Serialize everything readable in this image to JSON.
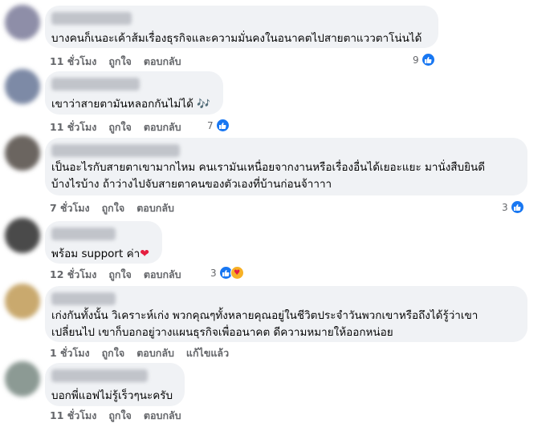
{
  "comments": [
    {
      "text": "บางคนก็เนอะเค้าส้มเรื่องธุรกิจและความมั่นคงในอนาคตไปสายตาแววตาโน่นได้",
      "time": "11 ชั่วโมง",
      "like": "ถูกใจ",
      "reply": "ตอบกลับ",
      "reactions": "9",
      "avatar_color": "#8e8ea8"
    },
    {
      "text": "เขาว่าสายตามันหลอกกันไม่ได้ 🎶",
      "time": "11 ชั่วโมง",
      "like": "ถูกใจ",
      "reply": "ตอบกลับ",
      "reactions": "7",
      "avatar_color": "#7d8aa6"
    },
    {
      "text": "เป็นอะไรกับสายตาเขามากไหม คนเรามันเหนื่อยจากงานหรือเรื่องอื่นได้เยอะแยะ มานั่งสืบยินดี\nบ้างไรบ้าง ถ้าว่างไปจับสายตาคนของตัวเองที่บ้านก่อนจ้าาาา",
      "time": "7 ชั่วโมง",
      "like": "ถูกใจ",
      "reply": "ตอบกลับ",
      "reactions": "3",
      "avatar_color": "#6b6560"
    },
    {
      "text": "พร้อม support ค่า",
      "heart": "❤",
      "time": "12 ชั่วโมง",
      "like": "ถูกใจ",
      "reply": "ตอบกลับ",
      "reactions": "3",
      "avatar_color": "#4a4a4a"
    },
    {
      "text": "เก่งกันทั้งนั้น วิเคราะห์เก่ง พวกคุณๆทั้งหลายคุณอยู่ในชีวิตประจำวันพวกเขาหรือถึงได้รู้ว่าเขา\nเปลี่ยนไป เขาก็บอกอยู่วางแผนธุรกิจเพื่ออนาคต ดีความหมายให้ออกหน่อย",
      "time": "1 ชั่วโมง",
      "like": "ถูกใจ",
      "reply": "ตอบกลับ",
      "edited": "แก้ไขแล้ว",
      "avatar_color": "#c9a96e"
    },
    {
      "text": "บอกพี่แอฟไม่รู้เร็วๆนะครับ",
      "time": "11 ชั่วโมง",
      "like": "ถูกใจ",
      "reply": "ตอบกลับ",
      "avatar_color": "#8c9a94"
    }
  ],
  "icons": {
    "like": "thumbs-up-icon",
    "care": "care-reaction-icon"
  }
}
